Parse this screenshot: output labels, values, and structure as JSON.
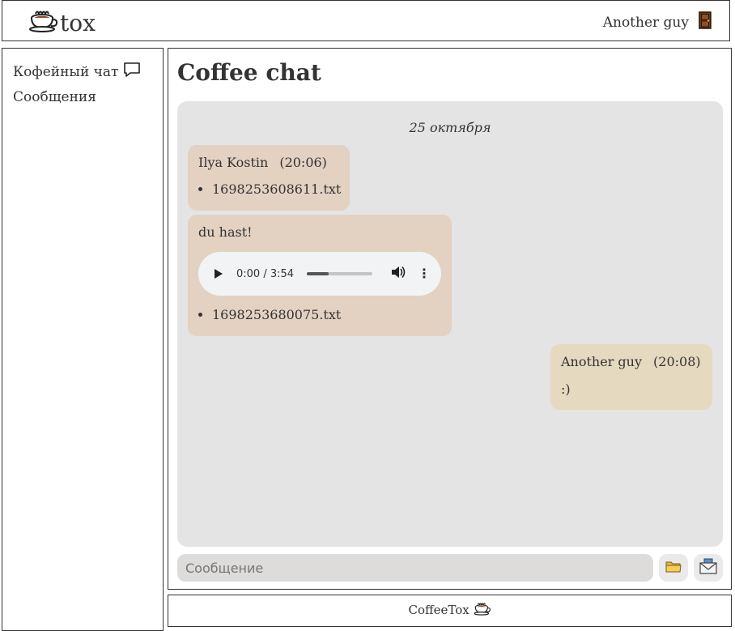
{
  "header": {
    "logo_text": "tox",
    "user_name": "Another guy",
    "logo_icon": "coffee-cup-icon",
    "logout_icon": "door-icon"
  },
  "sidebar": {
    "items": [
      {
        "label": "Кофейный чат",
        "icon": "speech-bubble-icon"
      },
      {
        "label": "Сообщения"
      }
    ]
  },
  "main": {
    "title": "Coffee chat",
    "date_separator": "25 октября",
    "messages": [
      {
        "author": "Ilya Kostin",
        "time": "(20:06)",
        "files": [
          "1698253608611.txt"
        ]
      },
      {
        "text": "du hast!",
        "audio": {
          "time": "0:00 / 3:54",
          "progress": 0.33
        },
        "files": [
          "1698253680075.txt"
        ]
      },
      {
        "author": "Another guy",
        "time": "(20:08)",
        "text": ":)"
      }
    ]
  },
  "composer": {
    "placeholder": "Сообщение",
    "attach_icon": "folder-icon",
    "send_icon": "envelope-icon"
  },
  "footer": {
    "text": "CoffeeTox"
  },
  "colors": {
    "chat_background": "#e4e4e4",
    "incoming_bubble": "#e3d1c2",
    "outgoing_bubble": "#e5d9c0"
  }
}
